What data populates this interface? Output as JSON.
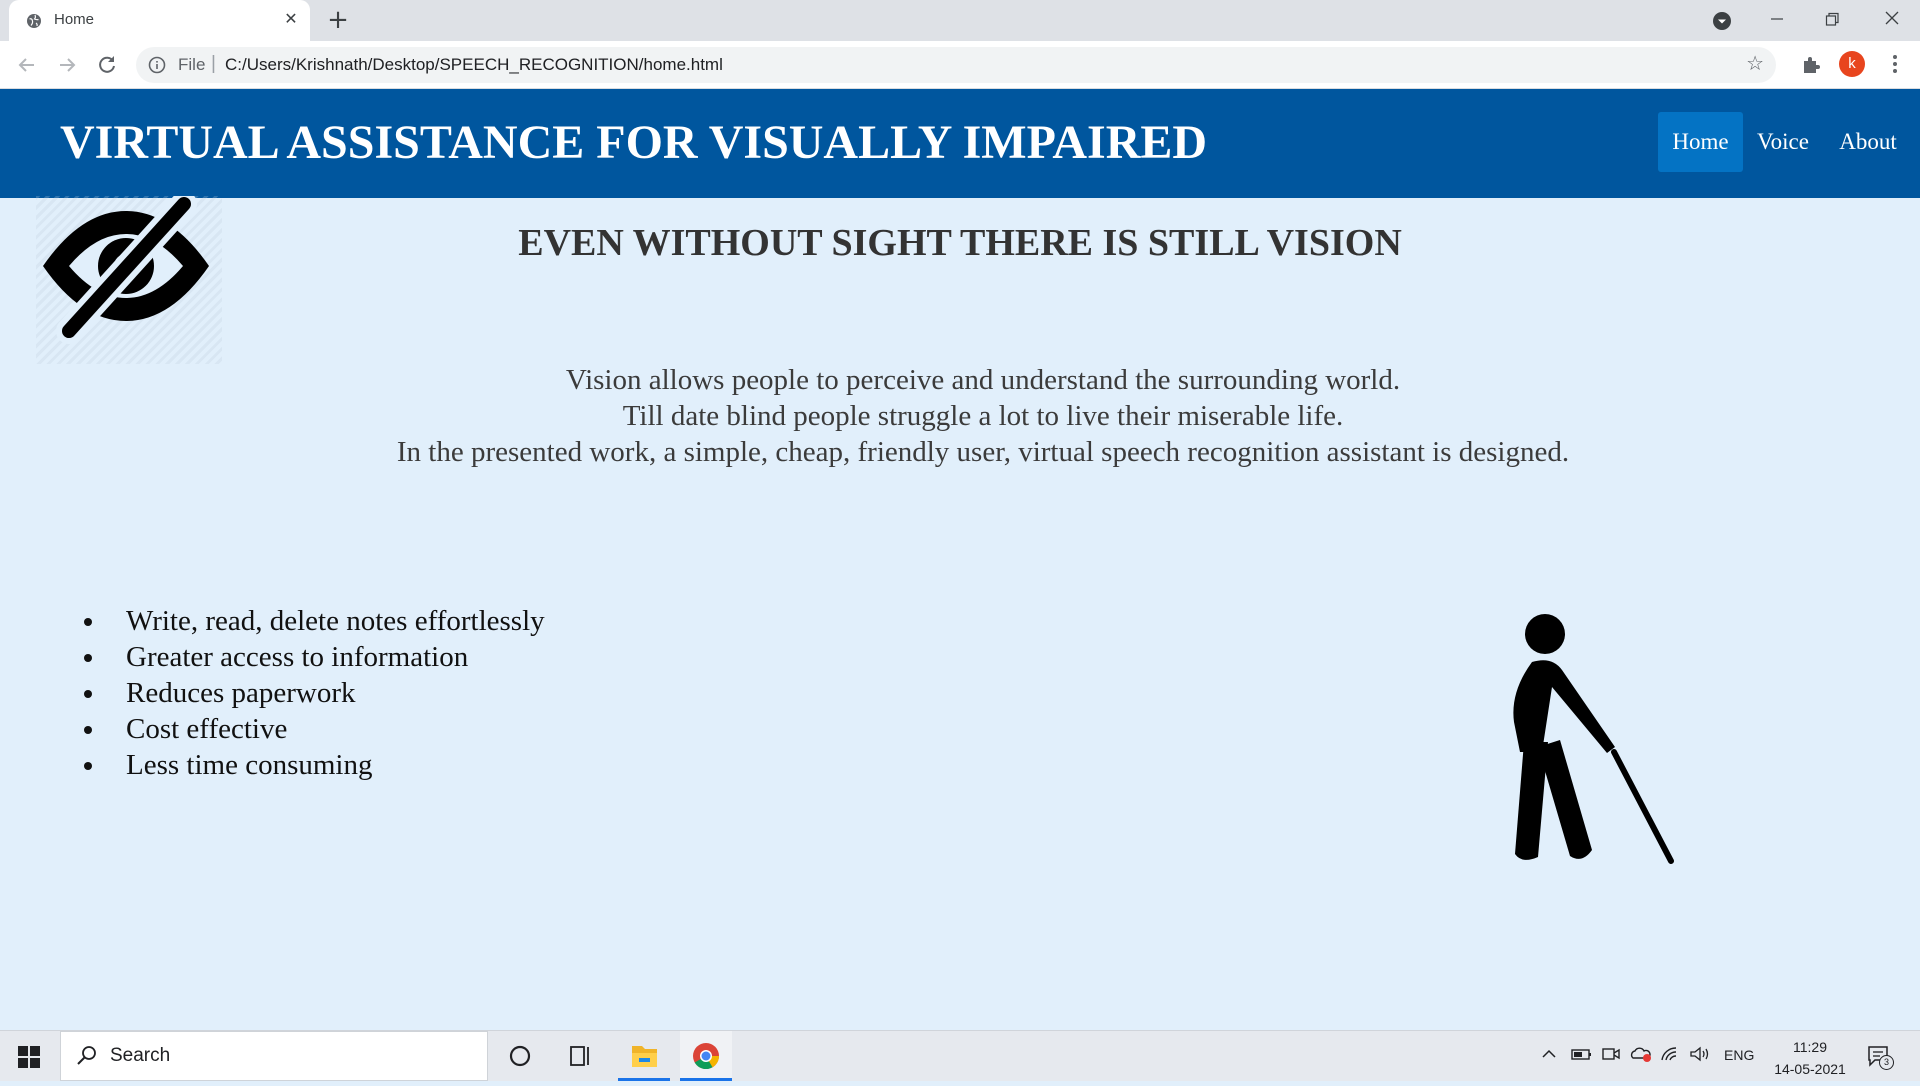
{
  "browser": {
    "tab_title": "Home",
    "tab_close": "✕",
    "new_tab": "+",
    "scheme_label": "File",
    "url": "C:/Users/Krishnath/Desktop/SPEECH_RECOGNITION/home.html",
    "profile_initial": "k",
    "icons": [
      "globe-icon",
      "tab-search-icon",
      "back-arrow-icon",
      "forward-arrow-icon",
      "reload-icon",
      "info-icon",
      "star-icon",
      "extensions-icon",
      "menu-icon",
      "minimize-icon",
      "maximize-icon",
      "close-icon"
    ]
  },
  "page": {
    "site_title": "VIRTUAL ASSISTANCE FOR VISUALLY IMPAIRED",
    "nav": [
      {
        "label": "Home",
        "active": true
      },
      {
        "label": "Voice",
        "active": false
      },
      {
        "label": "About",
        "active": false
      }
    ],
    "tagline": "EVEN WITHOUT SIGHT THERE IS STILL VISION",
    "intro_lines": [
      "Vision allows people to perceive and understand the surrounding world.",
      "Till date blind people struggle a lot to live their miserable life.",
      "In the presented work, a simple, cheap, friendly user, virtual speech recognition assistant is designed."
    ],
    "features": [
      "Write, read, delete notes effortlessly",
      "Greater access to information",
      "Reduces paperwork",
      "Cost effective",
      "Less time consuming"
    ],
    "images": [
      "eye-slash-icon",
      "blind-person-with-cane-icon"
    ]
  },
  "taskbar": {
    "search_placeholder": "Search",
    "language": "ENG",
    "time": "11:29",
    "date": "14-05-2021",
    "notification_count": "3",
    "icons": [
      "windows-start-icon",
      "search-icon",
      "cortana-icon",
      "task-view-icon",
      "file-explorer-icon",
      "chrome-icon",
      "chevron-up-icon",
      "battery-icon",
      "meet-now-icon",
      "onedrive-icon",
      "wifi-icon",
      "volume-icon",
      "notification-icon"
    ]
  }
}
